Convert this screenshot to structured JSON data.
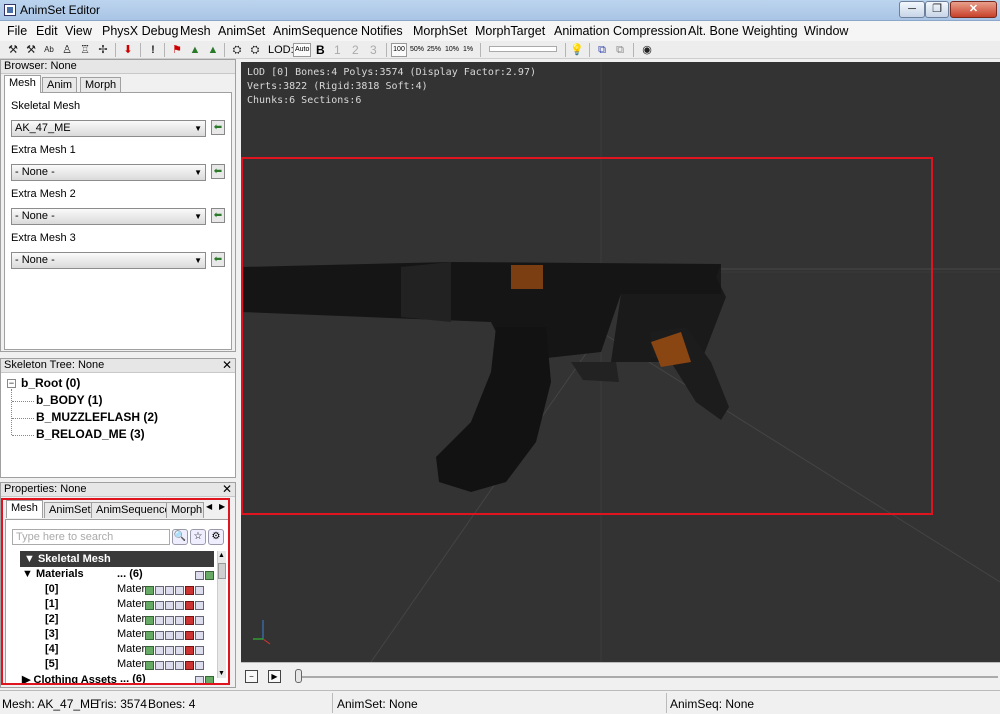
{
  "window": {
    "title": "AnimSet Editor",
    "min_glyph": "─",
    "max_glyph": "❐",
    "close_glyph": "✕"
  },
  "menu": [
    "File",
    "Edit",
    "View",
    "PhysX Debug",
    "Mesh",
    "AnimSet",
    "AnimSequence",
    "Notifies",
    "MorphSet",
    "MorphTarget",
    "Animation Compression",
    "Alt. Bone Weighting",
    "Window"
  ],
  "toolbar": {
    "lod_label": "LOD:",
    "auto_label": "Auto",
    "base_label": "B",
    "lod_levels": [
      "1",
      "2",
      "3"
    ],
    "zoom_levels": [
      "100",
      "50%",
      "25%",
      "10%",
      "1%"
    ]
  },
  "browser": {
    "title": "Browser: None",
    "tabs": [
      "Mesh",
      "Anim",
      "Morph"
    ],
    "skeletal_mesh_label": "Skeletal Mesh",
    "skeletal_mesh_value": "AK_47_ME",
    "extra1_label": "Extra Mesh 1",
    "extra1_value": "- None -",
    "extra2_label": "Extra Mesh 2",
    "extra2_value": "- None -",
    "extra3_label": "Extra Mesh 3",
    "extra3_value": "- None -"
  },
  "skeleton": {
    "title": "Skeleton Tree: None",
    "root": "b_Root (0)",
    "children": [
      "b_BODY (1)",
      "B_MUZZLEFLASH (2)",
      "B_RELOAD_ME (3)"
    ]
  },
  "properties": {
    "title": "Properties: None",
    "tabs": [
      "Mesh",
      "AnimSet",
      "AnimSequence",
      "Morph"
    ],
    "search_placeholder": "Type here to search",
    "section": "Skeletal Mesh",
    "materials_label": "Materials",
    "materials_value": "... (6)",
    "material_items": [
      "[0]",
      "[1]",
      "[2]",
      "[3]",
      "[4]",
      "[5]"
    ],
    "material_value": "Mater",
    "clothing_label": "Clothing Assets",
    "clothing_value": "... (6)"
  },
  "viewport": {
    "stats_line1": "LOD [0] Bones:4 Polys:3574 (Display Factor:2.97)",
    "stats_line2": "Verts:3822 (Rigid:3818 Soft:4)",
    "stats_line3": "Chunks:6 Sections:6"
  },
  "status": {
    "mesh": "Mesh: AK_47_ME",
    "tris": "Tris: 3574",
    "bones": "Bones: 4",
    "animset": "AnimSet: None",
    "animseq": "AnimSeq: None"
  },
  "colors": {
    "selection": "#e0141e",
    "viewport_bg": "#333333"
  }
}
